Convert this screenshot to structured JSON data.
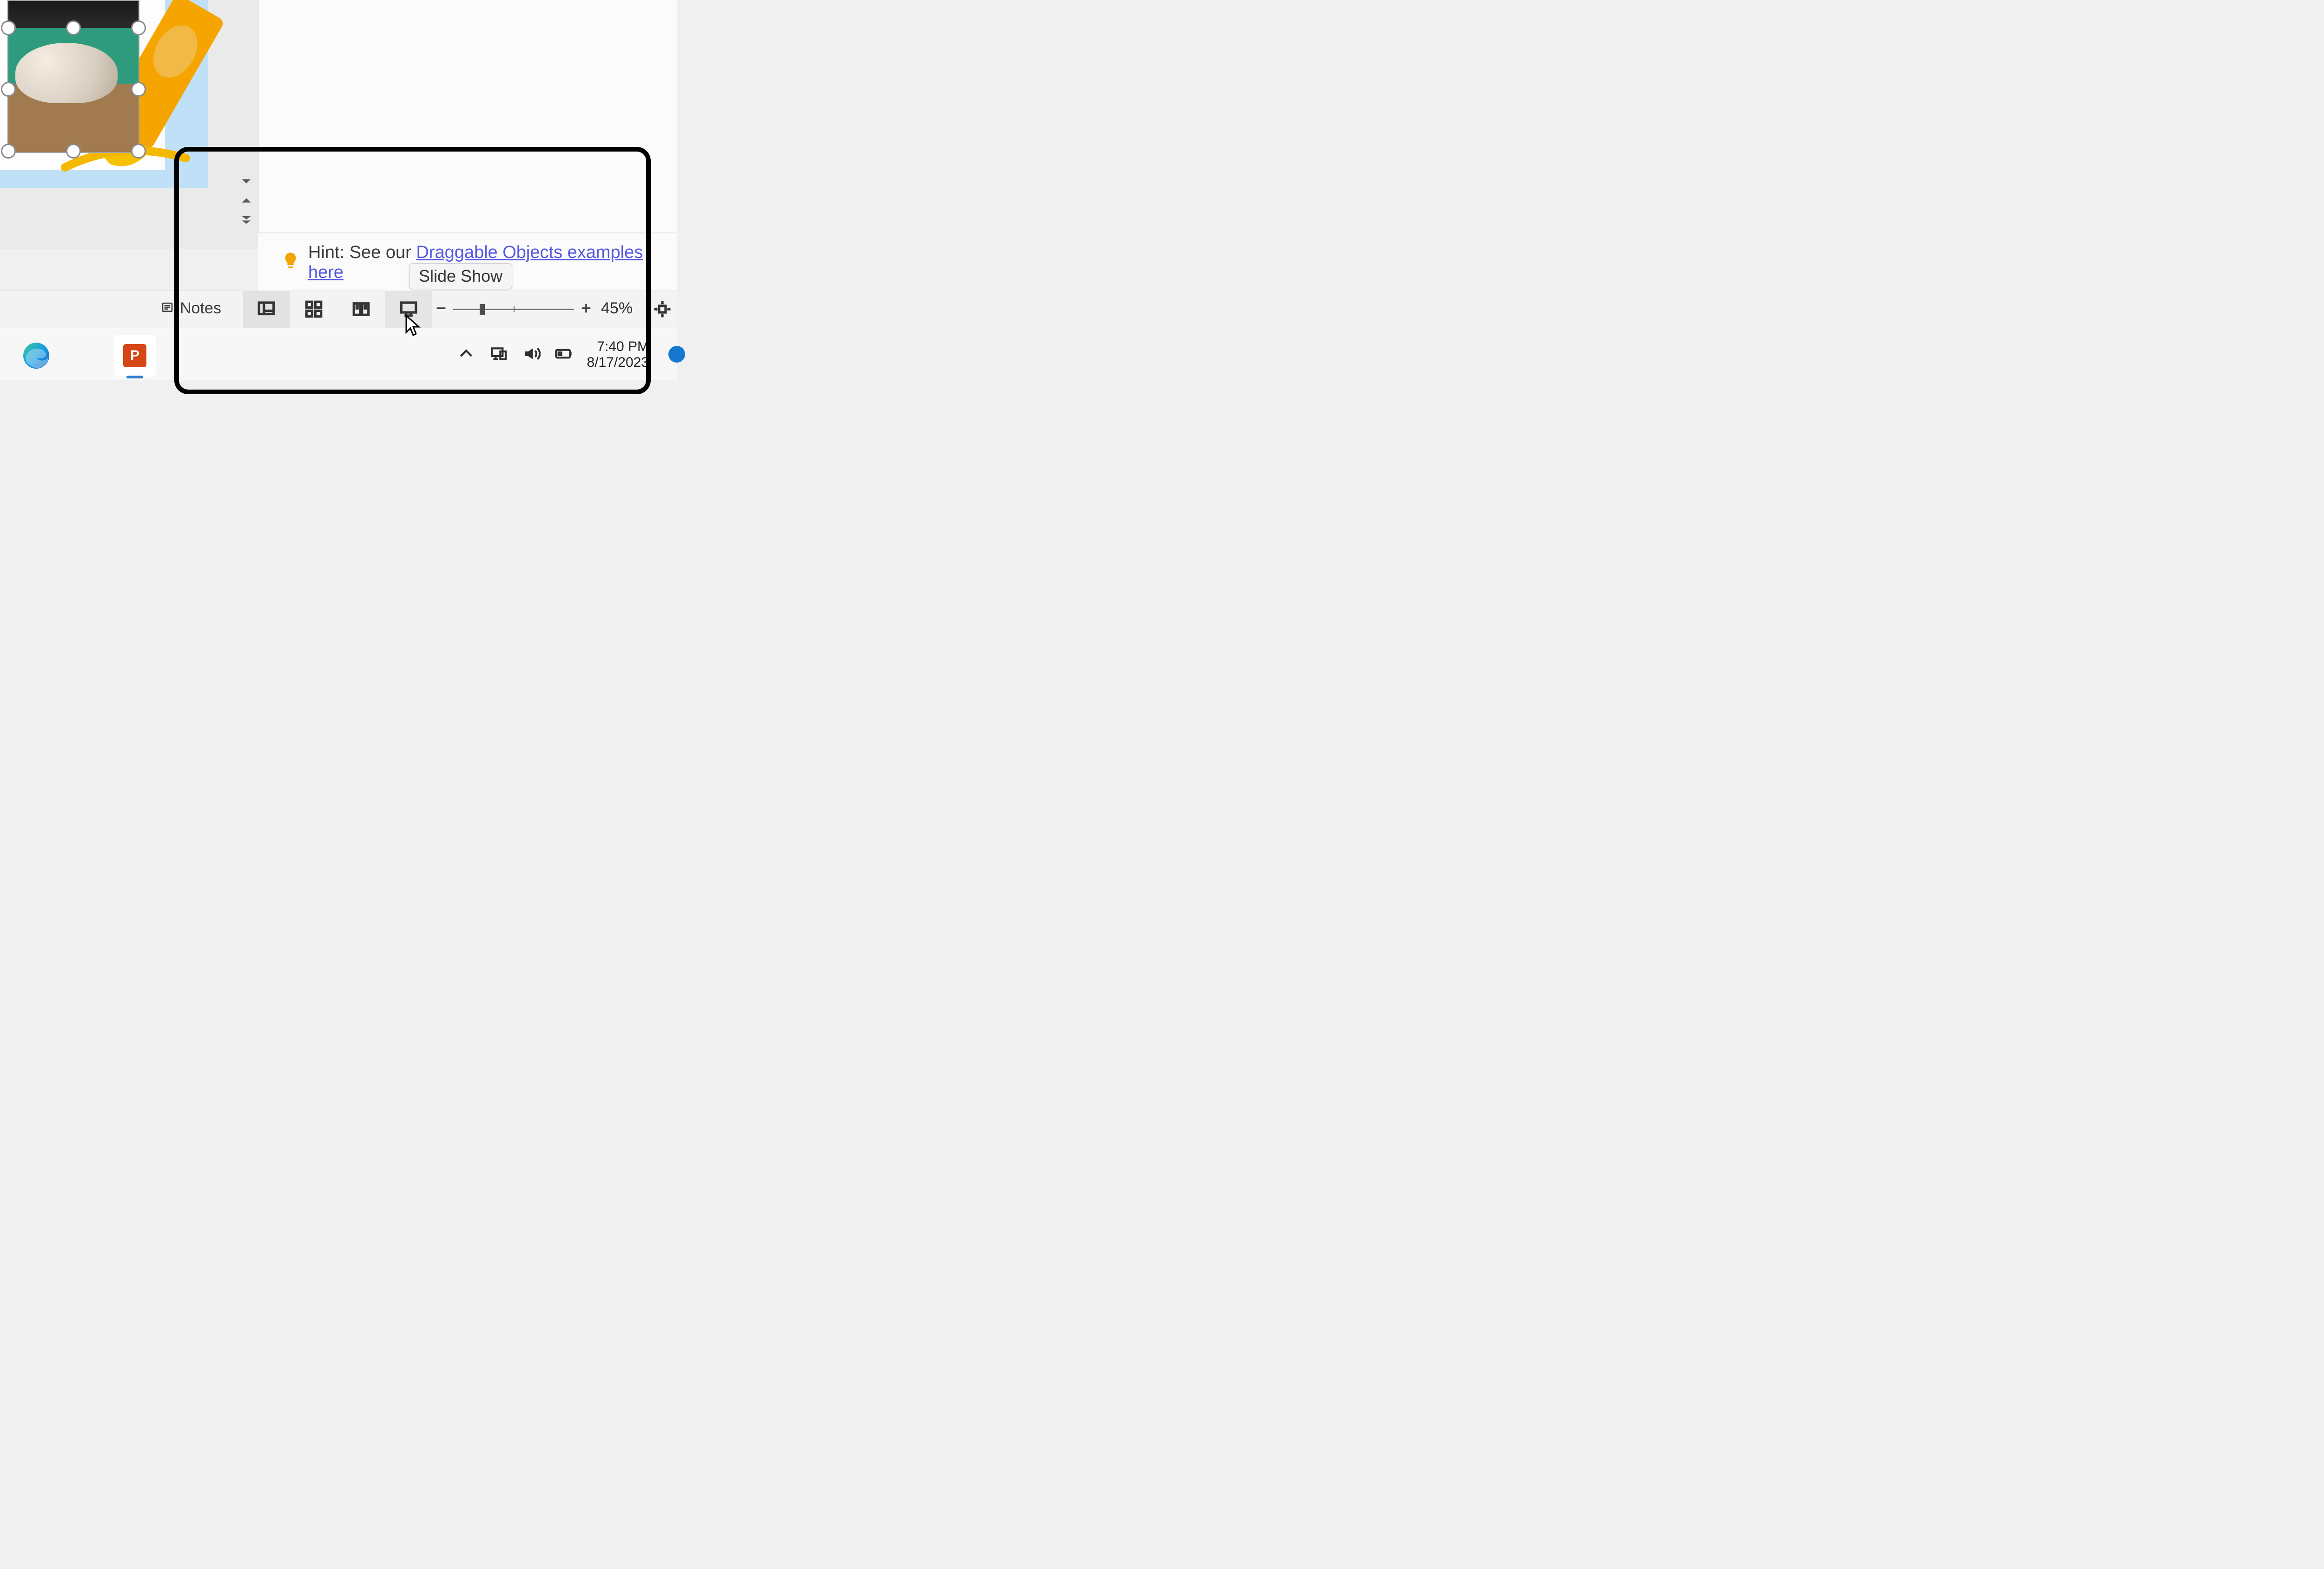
{
  "hint": {
    "prefix": "Hint: See our ",
    "link_text": "Draggable Objects examples here"
  },
  "tooltip": {
    "label": "Slide Show"
  },
  "statusbar": {
    "notes_label": "Notes",
    "zoom_label": "45%"
  },
  "taskbar": {
    "powerpoint_letter": "P",
    "time": "7:40 PM",
    "date": "8/17/2023"
  }
}
